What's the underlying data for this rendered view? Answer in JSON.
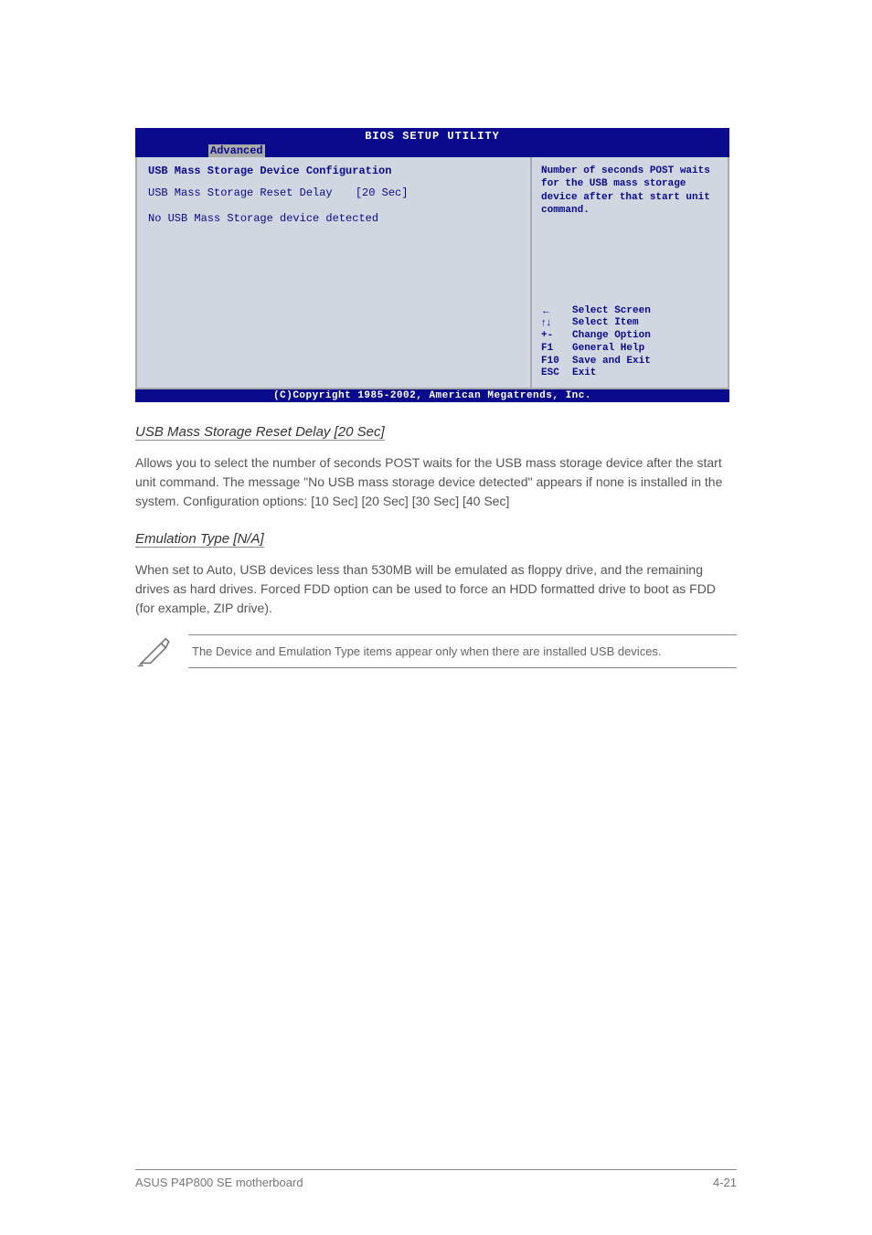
{
  "bios": {
    "title": "BIOS SETUP UTILITY",
    "tab": "Advanced",
    "section_header": "USB Mass Storage Device Configuration",
    "option_label": "USB Mass Storage Reset Delay",
    "option_value": "[20 Sec]",
    "no_device": "No USB Mass Storage device detected",
    "help_text": "Number of seconds POST waits for the USB mass storage device after that start unit command.",
    "keys": [
      {
        "k": "←",
        "a": "Select Screen"
      },
      {
        "k": "↑↓",
        "a": "Select Item"
      },
      {
        "k": "+-",
        "a": "Change Option"
      },
      {
        "k": "F1",
        "a": "General Help"
      },
      {
        "k": "F10",
        "a": "Save and Exit"
      },
      {
        "k": "ESC",
        "a": "Exit"
      }
    ],
    "copyright": "(C)Copyright 1985-2002, American Megatrends, Inc."
  },
  "doc": {
    "sub1_title": "USB Mass Storage Reset Delay [20 Sec]",
    "sub1_text": "Allows you to select the number of seconds POST waits for the USB mass storage device after the start unit command. The message \"No USB mass storage device detected\" appears if none is installed in the system. Configuration options: [10 Sec] [20 Sec] [30 Sec] [40 Sec]",
    "sub2_title": "Emulation Type [N/A]",
    "sub2_text": "When set to Auto, USB devices less than 530MB will be emulated as floppy drive, and the remaining drives as hard drives. Forced FDD option can be used to force an HDD formatted drive to boot as FDD (for example, ZIP drive).",
    "note_text": "The Device and Emulation Type items appear only when there are installed USB devices.",
    "footer_left": "ASUS P4P800 SE motherboard",
    "footer_right": "4-21"
  }
}
